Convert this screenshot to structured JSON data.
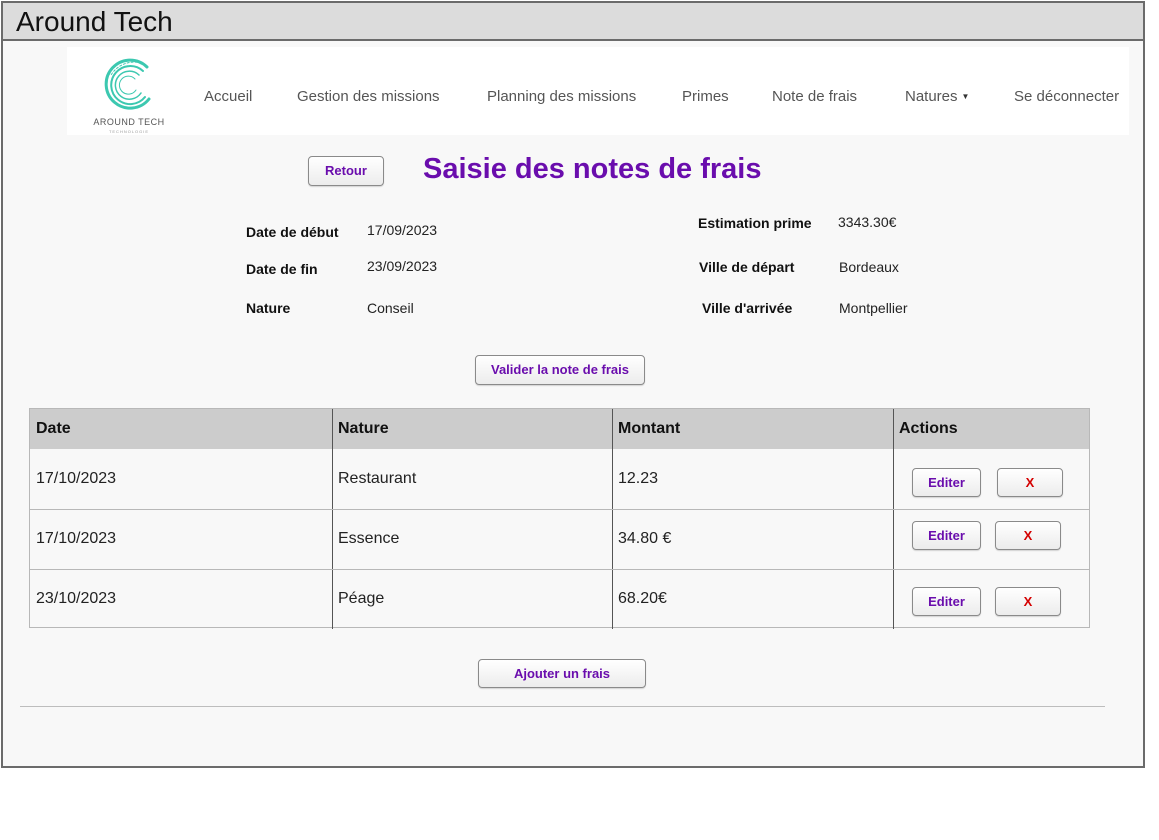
{
  "window": {
    "title": "Around Tech"
  },
  "brand": {
    "logo_text": "AROUND TECH",
    "logo_sub": "TECHNOLOGIE",
    "logo_color": "#3cc8b0"
  },
  "nav": {
    "items": [
      {
        "label": "Accueil"
      },
      {
        "label": "Gestion des missions"
      },
      {
        "label": "Planning des missions"
      },
      {
        "label": "Primes"
      },
      {
        "label": "Note de frais"
      },
      {
        "label": "Natures"
      },
      {
        "label": "Se déconnecter"
      }
    ]
  },
  "page": {
    "back_label": "Retour",
    "title": "Saisie des notes de frais",
    "accent": "#6a0dad",
    "delete_color": "#d40000"
  },
  "info": {
    "start_label": "Date de début",
    "start_value": "17/09/2023",
    "end_label": "Date de fin",
    "end_value": "23/09/2023",
    "nature_label": "Nature",
    "nature_value": "Conseil",
    "prime_label": "Estimation prime",
    "prime_value": "3343.30€",
    "depart_label": "Ville de départ",
    "depart_value": "Bordeaux",
    "arrivee_label": "Ville d'arrivée",
    "arrivee_value": "Montpellier"
  },
  "actions": {
    "validate_label": "Valider la note de frais",
    "add_label": "Ajouter un frais"
  },
  "table": {
    "headers": [
      "Date",
      "Nature",
      "Montant",
      "Actions"
    ],
    "rows": [
      {
        "date": "17/10/2023",
        "nature": "Restaurant",
        "montant": "12.23",
        "edit": "Editer",
        "delete": "X"
      },
      {
        "date": "17/10/2023",
        "nature": "Essence",
        "montant": "34.80 €",
        "edit": "Editer",
        "delete": "X"
      },
      {
        "date": "23/10/2023",
        "nature": "Péage",
        "montant": "68.20€",
        "edit": "Editer",
        "delete": "X"
      }
    ]
  }
}
